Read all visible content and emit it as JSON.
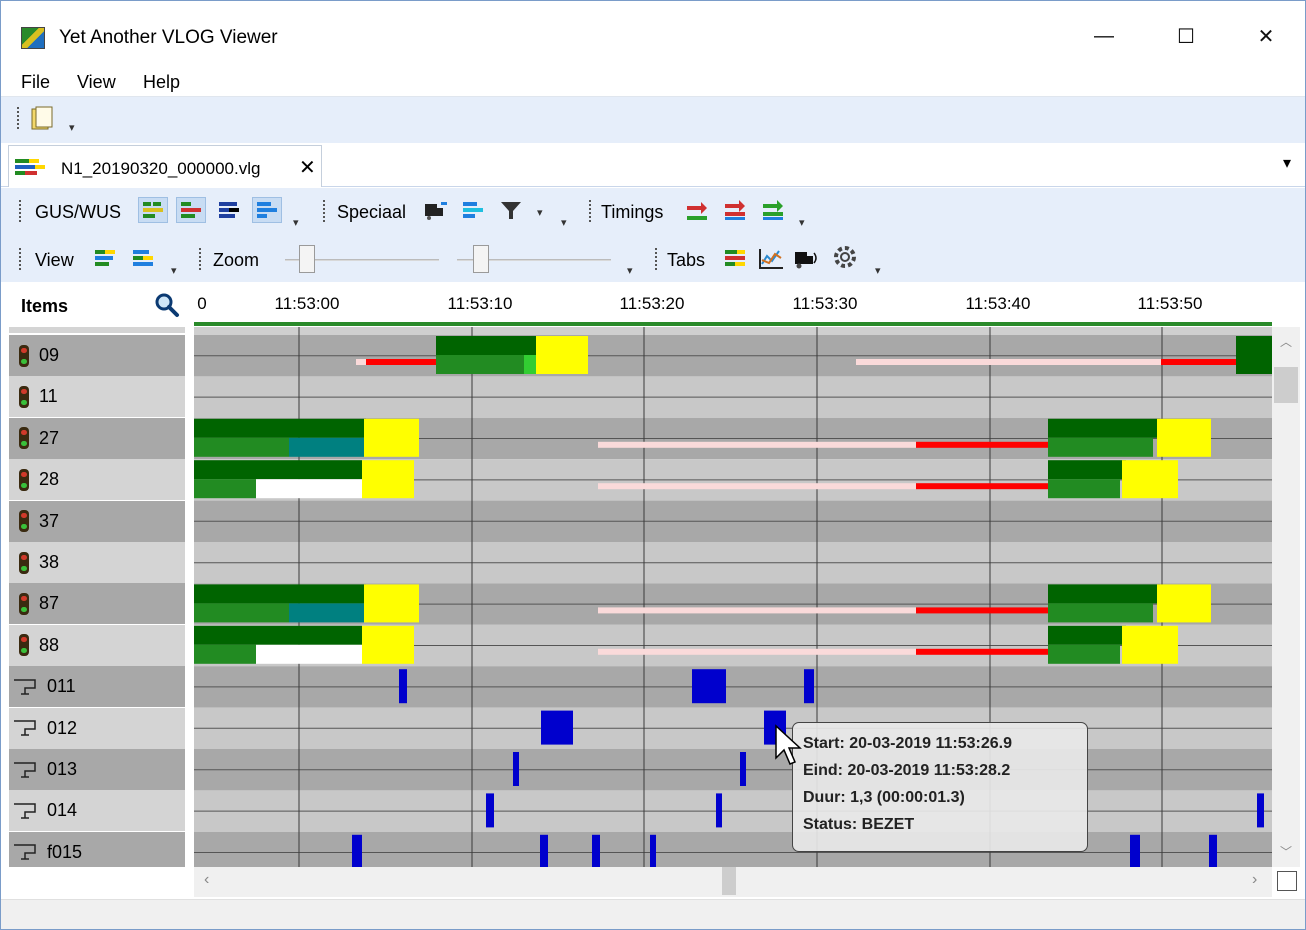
{
  "window": {
    "title": "Yet Another VLOG Viewer",
    "minimize": "—",
    "maximize": "☐",
    "close": "✕"
  },
  "menu": [
    "File",
    "View",
    "Help"
  ],
  "document_tab": {
    "label": "N1_20190320_000000.vlg",
    "close": "✕",
    "overflow": "▾"
  },
  "toolbar": {
    "groups": [
      "GUS/WUS",
      "Speciaal",
      "Timings",
      "View",
      "Zoom",
      "Tabs"
    ]
  },
  "sidebar": {
    "header": "Items",
    "search_icon": "search-icon"
  },
  "timeline": {
    "ticks": [
      "0",
      "11:53:00",
      "11:53:10",
      "11:53:20",
      "11:53:30",
      "11:53:40",
      "11:53:50"
    ]
  },
  "rows": [
    {
      "label": "09",
      "kind": "signal"
    },
    {
      "label": "11",
      "kind": "signal"
    },
    {
      "label": "27",
      "kind": "signal"
    },
    {
      "label": "28",
      "kind": "signal"
    },
    {
      "label": "37",
      "kind": "signal"
    },
    {
      "label": "38",
      "kind": "signal"
    },
    {
      "label": "87",
      "kind": "signal"
    },
    {
      "label": "88",
      "kind": "signal"
    },
    {
      "label": "011",
      "kind": "detector"
    },
    {
      "label": "012",
      "kind": "detector"
    },
    {
      "label": "013",
      "kind": "detector"
    },
    {
      "label": "014",
      "kind": "detector"
    },
    {
      "label": "f015",
      "kind": "detector"
    }
  ],
  "tooltip": {
    "start": "Start: 20-03-2019 11:53:26.9",
    "end": "Eind: 20-03-2019 11:53:28.2",
    "duration": "Duur: 1,3 (00:00:01.3)",
    "status": "Status: BEZET"
  },
  "colors": {
    "green_dark": "#006400",
    "green": "#228b22",
    "yellow": "#ffff00",
    "red": "#ff0000",
    "detector_blue": "#0000cd",
    "teal": "#008080"
  }
}
